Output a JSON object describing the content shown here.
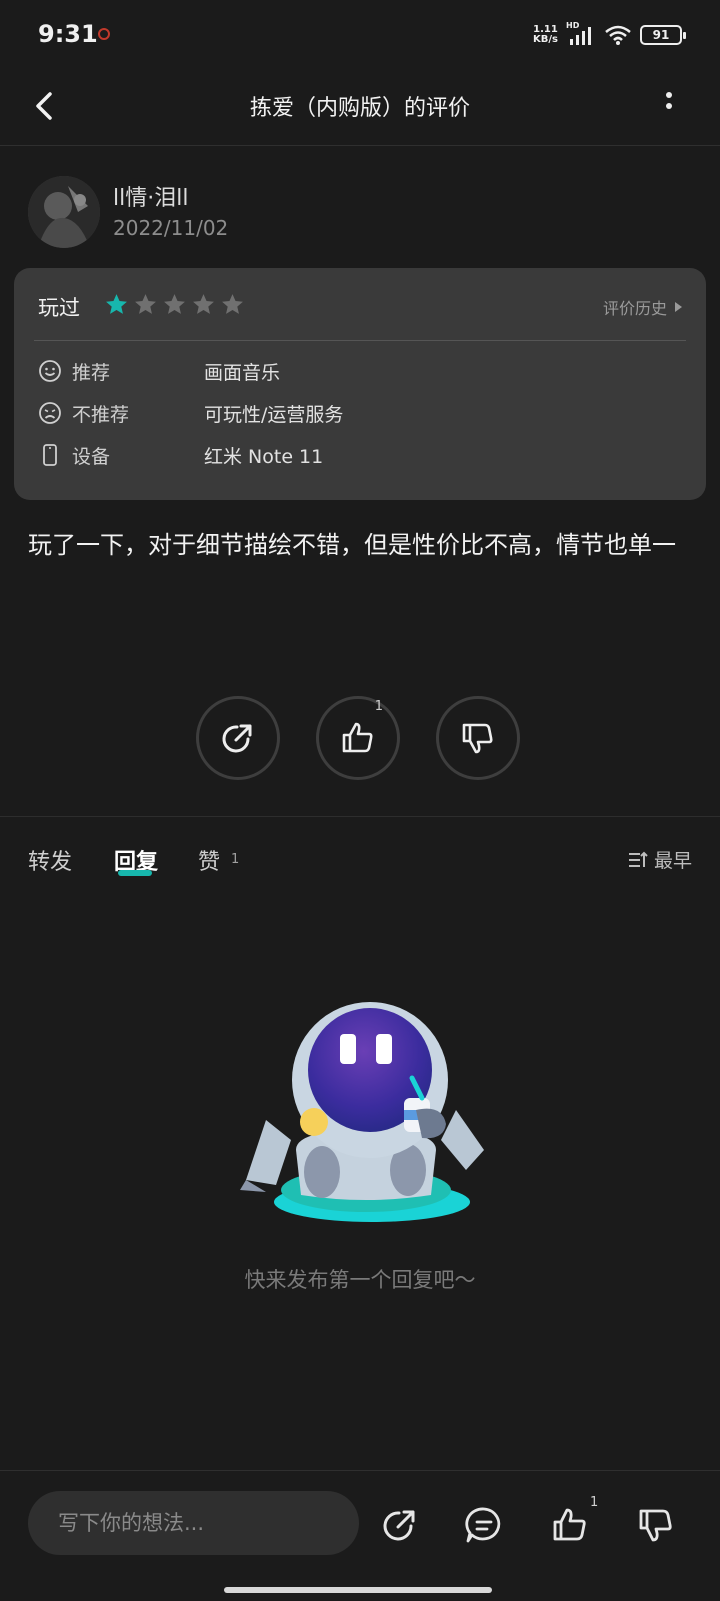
{
  "status_bar": {
    "time": "9:31",
    "net_speed_value": "1.11",
    "net_speed_unit": "KB/s",
    "hd_label": "HD",
    "battery": "91"
  },
  "header": {
    "title": "拣爱（内购版）的评价"
  },
  "user": {
    "name": "ll情·泪ll",
    "date": "2022/11/02"
  },
  "rating_card": {
    "status_label": "玩过",
    "rating": 1,
    "max_rating": 5,
    "history_label": "评价历史",
    "rows": [
      {
        "label": "推荐",
        "value": "画面音乐",
        "icon": "smile-icon"
      },
      {
        "label": "不推荐",
        "value": "可玩性/运营服务",
        "icon": "frown-icon"
      },
      {
        "label": "设备",
        "value": "红米 Note 11",
        "icon": "phone-icon"
      }
    ]
  },
  "review": {
    "text": "玩了一下，对于细节描绘不错，但是性价比不高，情节也单一"
  },
  "actions": {
    "like_count": "1"
  },
  "tabs": {
    "items": [
      {
        "label": "转发"
      },
      {
        "label": "回复"
      },
      {
        "label": "赞"
      }
    ],
    "active": "回复",
    "like_count": "1",
    "sort_label": "最早"
  },
  "empty_state": {
    "text": "快来发布第一个回复吧～"
  },
  "bottom_bar": {
    "input_placeholder": "写下你的想法...",
    "like_count": "1"
  },
  "colors": {
    "accent": "#17b7ad",
    "background": "#1b1b1b",
    "card": "#3a3a3a",
    "star_empty": "#707070"
  }
}
